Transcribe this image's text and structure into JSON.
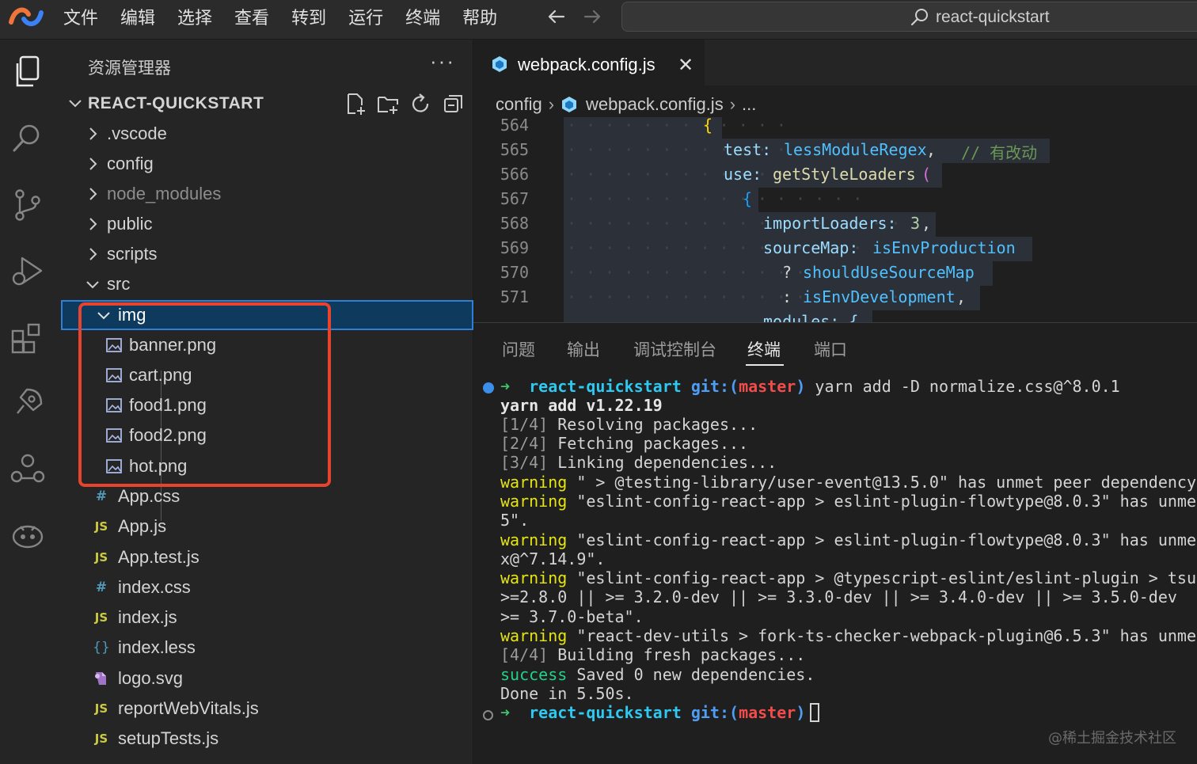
{
  "titlebar": {
    "menu": [
      "文件",
      "编辑",
      "选择",
      "查看",
      "转到",
      "运行",
      "终端",
      "帮助"
    ],
    "command_center": "react-quickstart"
  },
  "activity_bar": [
    "explorer-icon",
    "search-icon",
    "source-control-icon",
    "run-debug-icon",
    "extensions-icon",
    "remote-explorer-icon",
    "live-share-icon",
    "copilot-icon"
  ],
  "sidebar": {
    "header": "资源管理器",
    "more": "···",
    "project": "REACT-QUICKSTART",
    "folders": [
      ".vscode",
      "config",
      "node_modules",
      "public",
      "scripts",
      "src"
    ],
    "img_folder": "img",
    "img_files": [
      "banner.png",
      "cart.png",
      "food1.png",
      "food2.png",
      "hot.png"
    ],
    "src_files": [
      {
        "name": "App.css",
        "icon": "#"
      },
      {
        "name": "App.js",
        "icon": "JS"
      },
      {
        "name": "App.test.js",
        "icon": "JS"
      },
      {
        "name": "index.css",
        "icon": "#"
      },
      {
        "name": "index.js",
        "icon": "JS"
      },
      {
        "name": "index.less",
        "icon": "{}"
      },
      {
        "name": "logo.svg",
        "icon": "svg"
      },
      {
        "name": "reportWebVitals.js",
        "icon": "JS"
      },
      {
        "name": "setupTests.js",
        "icon": "JS"
      }
    ]
  },
  "editor": {
    "tab_label": "webpack.config.js",
    "tab_close": "✕",
    "breadcrumb": [
      "config",
      "webpack.config.js",
      "..."
    ],
    "line_numbers": [
      "564",
      "565",
      "566",
      "567",
      "568",
      "569",
      "570",
      "571"
    ],
    "code": {
      "l564": "{",
      "l565_prop": "test:",
      "l565_val": "lessModuleRegex",
      "l565_comment": "// 有改动",
      "l566_prop": "use:",
      "l566_fn": "getStyleLoaders",
      "l566_paren": "(",
      "l567": "{",
      "l568_prop": "importLoaders:",
      "l568_num": "3",
      "l569_prop": "sourceMap:",
      "l569_val": "isEnvProduction",
      "l570_op": "?",
      "l570_val": "shouldUseSourceMap",
      "l571_op": ":",
      "l571_val": "isEnvDevelopment",
      "l572_partial": "modules: {"
    }
  },
  "panel": {
    "tabs": [
      "问题",
      "输出",
      "调试控制台",
      "终端",
      "端口"
    ],
    "active_tab": "终端",
    "prompt_dir": "react-quickstart",
    "prompt_git": "git:(",
    "prompt_branch": "master",
    "prompt_git_close": ")",
    "command": "yarn add -D normalize.css@^8.0.1",
    "yarn_version": "yarn add v1.22.19",
    "steps": [
      {
        "tag": "[1/4]",
        "text": "Resolving packages..."
      },
      {
        "tag": "[2/4]",
        "text": "Fetching packages..."
      },
      {
        "tag": "[3/4]",
        "text": "Linking dependencies..."
      }
    ],
    "warnings": [
      "\" > @testing-library/user-event@13.5.0\" has unmet peer dependency",
      "\"eslint-config-react-app > eslint-plugin-flowtype@8.0.3\" has unme",
      "\"eslint-config-react-app > eslint-plugin-flowtype@8.0.3\" has unme",
      "\"eslint-config-react-app > @typescript-eslint/eslint-plugin > tsu",
      "\"react-dev-utils > fork-ts-checker-webpack-plugin@6.5.3\" has unme"
    ],
    "warning_label": "warning",
    "wrap_lines": [
      "5\".",
      "x@^7.14.9\".",
      ">=2.8.0 || >= 3.2.0-dev || >= 3.3.0-dev || >= 3.4.0-dev || >= 3.5.0-dev",
      ">= 3.7.0-beta\"."
    ],
    "step4": {
      "tag": "[4/4]",
      "text": "Building fresh packages..."
    },
    "success_label": "success",
    "success_text": "Saved 0 new dependencies.",
    "done": "Done in 5.50s.",
    "arrow": "➜"
  },
  "watermark": "@稀土掘金技术社区",
  "colors": {
    "accent_red_box": "#e8432d",
    "selection_blue": "#0e3a5e",
    "terminal_green": "#3fc56b",
    "terminal_yellow": "#e5e510"
  }
}
